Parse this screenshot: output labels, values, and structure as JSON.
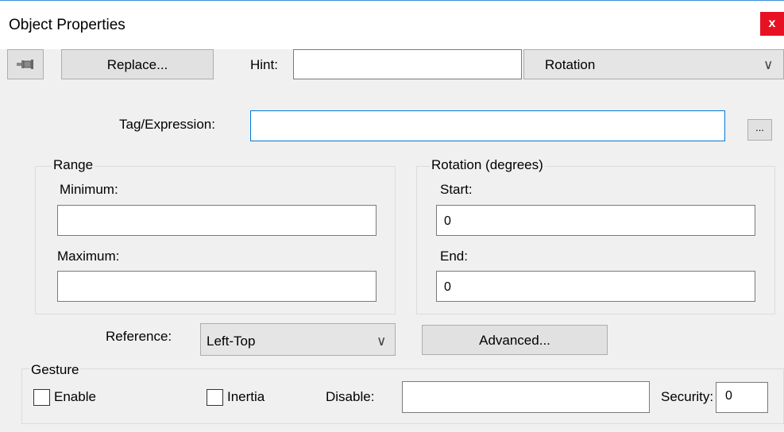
{
  "window": {
    "title": "Object Properties",
    "close_label": "x"
  },
  "toolbar": {
    "pin_icon": "pushpin-icon",
    "replace_label": "Replace...",
    "hint_label": "Hint:",
    "hint_value": "",
    "type_select_value": "Rotation",
    "chevron": "∨"
  },
  "tag": {
    "label": "Tag/Expression:",
    "value": "",
    "browse_label": "..."
  },
  "range": {
    "legend": "Range",
    "minimum_label": "Minimum:",
    "minimum_value": "",
    "maximum_label": "Maximum:",
    "maximum_value": ""
  },
  "rotation": {
    "legend": "Rotation (degrees)",
    "start_label": "Start:",
    "start_value": "0",
    "end_label": "End:",
    "end_value": "0"
  },
  "reference": {
    "label": "Reference:",
    "value": "Left-Top",
    "chevron": "∨"
  },
  "advanced_label": "Advanced...",
  "gesture": {
    "legend": "Gesture",
    "enable_label": "Enable",
    "enable_checked": false,
    "inertia_label": "Inertia",
    "inertia_checked": false,
    "disable_label": "Disable:",
    "disable_value": "",
    "security_label": "Security:",
    "security_value": "0"
  },
  "colors": {
    "close_button": "#e81123",
    "focus_border": "#0078d7",
    "window_bg": "#f0f0f0"
  }
}
